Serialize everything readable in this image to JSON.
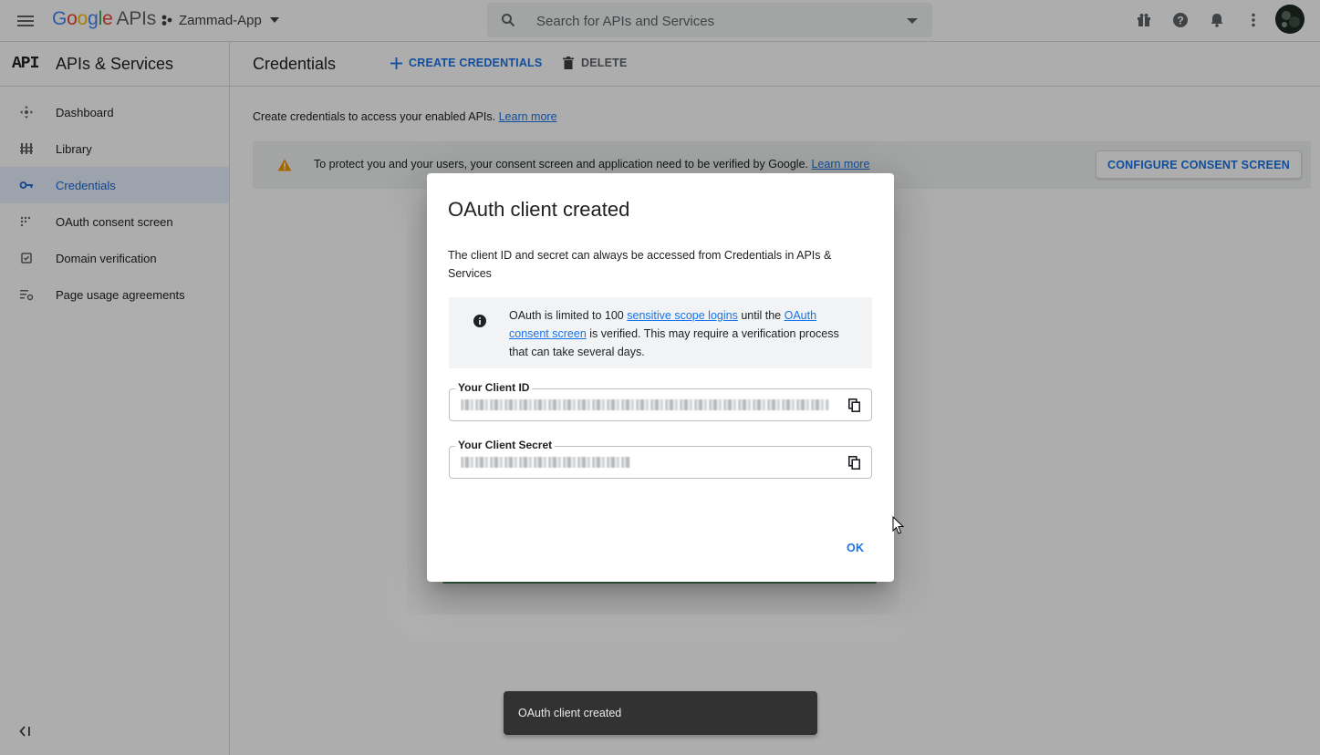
{
  "topbar": {
    "logo_google": "Google",
    "logo_apis": "APIs",
    "project_name": "Zammad-App",
    "search_placeholder": "Search for APIs and Services",
    "icons": [
      "menu-icon",
      "gift-icon",
      "help-icon",
      "notifications-icon",
      "more-vert-icon",
      "account-avatar"
    ]
  },
  "sidenav": {
    "badge": "API",
    "title": "APIs & Services",
    "items": [
      {
        "label": "Dashboard",
        "icon": "dashboard-icon",
        "active": false
      },
      {
        "label": "Library",
        "icon": "library-icon",
        "active": false
      },
      {
        "label": "Credentials",
        "icon": "key-icon",
        "active": true
      },
      {
        "label": "OAuth consent screen",
        "icon": "consent-icon",
        "active": false
      },
      {
        "label": "Domain verification",
        "icon": "domain-icon",
        "active": false
      },
      {
        "label": "Page usage agreements",
        "icon": "settings-list-icon",
        "active": false
      }
    ]
  },
  "main": {
    "title": "Credentials",
    "create_label": "CREATE CREDENTIALS",
    "delete_label": "DELETE",
    "intro_text": "Create credentials to access your enabled APIs.",
    "intro_link": "Learn more",
    "warning_text": "To protect you and your users, your consent screen and application need to be verified by Google.",
    "warning_link": "Learn more",
    "configure_label": "CONFIGURE CONSENT SCREEN"
  },
  "dialog": {
    "title": "OAuth client created",
    "subtitle": "The client ID and secret can always be accessed from Credentials in APIs & Services",
    "info_text_1": "OAuth is limited to 100",
    "info_link_1": "sensitive scope logins",
    "info_text_2": "until the",
    "info_link_2": "OAuth consent screen",
    "info_text_3": "is verified. This may require a verification process that can take several days.",
    "client_id_label": "Your Client ID",
    "client_secret_label": "Your Client Secret",
    "ok_label": "OK"
  },
  "snackbar": {
    "message": "OAuth client created"
  },
  "colors": {
    "accent": "#1a73e8",
    "active_nav_bg": "#e8f0fe",
    "warning": "#f29900",
    "snackbar_bg": "#323232"
  }
}
